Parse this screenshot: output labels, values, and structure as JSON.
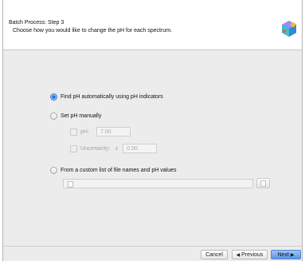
{
  "header": {
    "title": "Batch Process: Step 3",
    "subtitle": "Choose how you would like to change the pH for each spectrum."
  },
  "options": {
    "auto": {
      "label": "Find pH automatically using pH indicators",
      "selected": true
    },
    "manual": {
      "label": "Set pH manually",
      "selected": false,
      "ph_label": "pH:",
      "ph_value": "7.00",
      "uncertainty_label": "Uncertainty:",
      "plus_minus": "±",
      "uncertainty_value": "0.50"
    },
    "custom": {
      "label": "From a custom list of file names and pH values",
      "selected": false
    }
  },
  "footer": {
    "cancel": "Cancel",
    "previous": "Previous",
    "next": "Next"
  },
  "colors": {
    "accent": "#2a6fdc",
    "primary_button": "#5a95e6"
  }
}
